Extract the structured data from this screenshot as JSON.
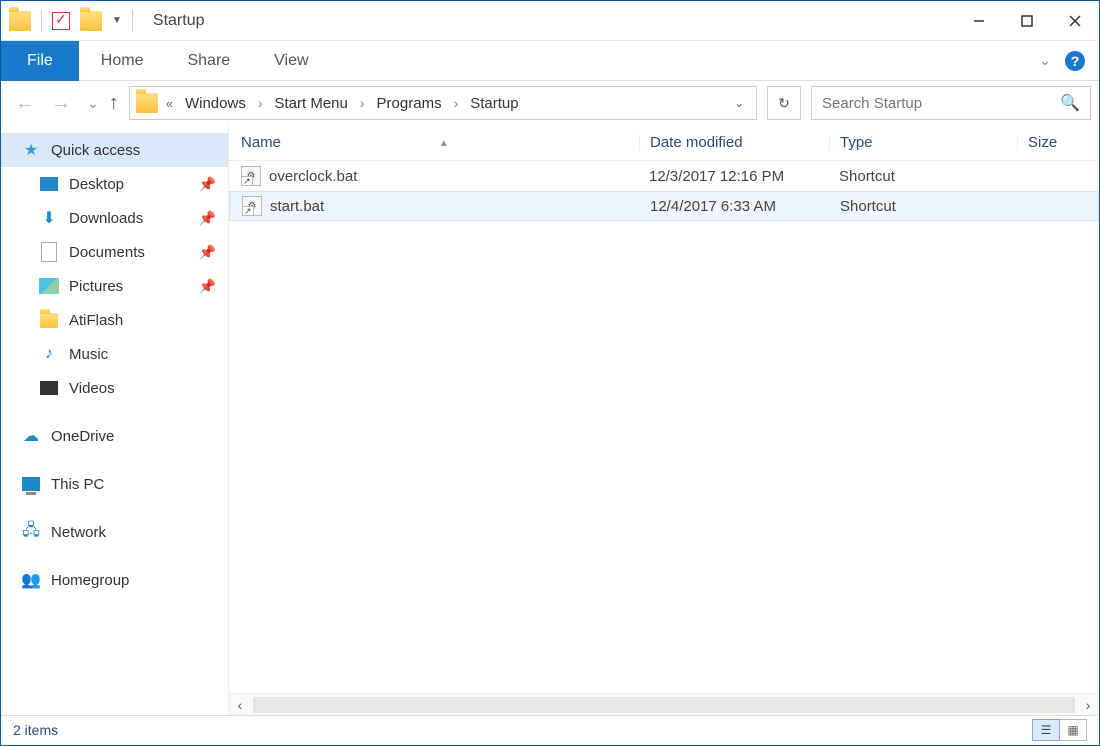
{
  "window": {
    "title": "Startup"
  },
  "ribbon": {
    "file": "File",
    "tabs": [
      "Home",
      "Share",
      "View"
    ]
  },
  "breadcrumb": [
    "Windows",
    "Start Menu",
    "Programs",
    "Startup"
  ],
  "search": {
    "placeholder": "Search Startup"
  },
  "sidebar": {
    "quick_access": "Quick access",
    "items": [
      {
        "label": "Desktop",
        "pinned": true
      },
      {
        "label": "Downloads",
        "pinned": true
      },
      {
        "label": "Documents",
        "pinned": true
      },
      {
        "label": "Pictures",
        "pinned": true
      },
      {
        "label": "AtiFlash",
        "pinned": false
      },
      {
        "label": "Music",
        "pinned": false
      },
      {
        "label": "Videos",
        "pinned": false
      }
    ],
    "onedrive": "OneDrive",
    "thispc": "This PC",
    "network": "Network",
    "homegroup": "Homegroup"
  },
  "columns": {
    "name": "Name",
    "date": "Date modified",
    "type": "Type",
    "size": "Size"
  },
  "files": [
    {
      "name": "overclock.bat",
      "date": "12/3/2017 12:16 PM",
      "type": "Shortcut",
      "size": ""
    },
    {
      "name": "start.bat",
      "date": "12/4/2017 6:33 AM",
      "type": "Shortcut",
      "size": ""
    }
  ],
  "status": {
    "items": "2 items"
  }
}
